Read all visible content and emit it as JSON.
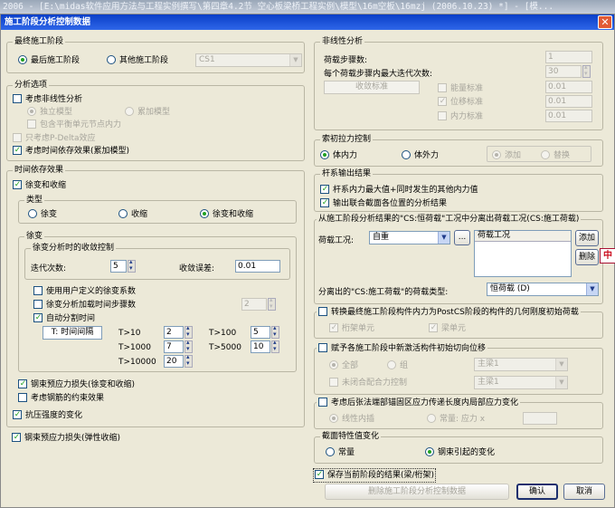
{
  "window": {
    "title": "2006 - [E:\\midas软件应用方法与工程实例撰写\\第四章4.2节 空心板梁桥工程实例\\模型\\16m空板\\16mzj (2006.10.23) *] - [模..."
  },
  "dialog": {
    "title": "施工阶段分析控制数据",
    "close_icon": "close-icon"
  },
  "final_stage": {
    "legend": "最终施工阶段",
    "last": "最后施工阶段",
    "other": "其他施工阶段",
    "other_value": "CS1"
  },
  "analysis": {
    "legend": "分析选项",
    "nonlinear": "考虑非线性分析",
    "independent": "独立模型",
    "cumulative": "累加模型",
    "balance_node": "包含平衡单元节点内力",
    "pdelta": "只考虑P-Delta效应",
    "time_dep": "考虑时间依存效果(累加模型)"
  },
  "time_dependent": {
    "legend": "时间依存效果",
    "creep_shrink": "徐变和收缩",
    "type_legend": "类型",
    "type_creep": "徐变",
    "type_shrink": "收缩",
    "type_both": "徐变和收缩",
    "creep_legend": "徐变",
    "conv_legend": "徐变分析时的收敛控制",
    "iterations_label": "迭代次数:",
    "iterations": "5",
    "error_label": "收敛误差:",
    "error": "0.01",
    "user_coef": "使用用户定义的徐变系数",
    "load_steps": "徐变分析加载时间步骤数",
    "load_steps_value": "2",
    "auto_split": "自动分割时间",
    "t_label": "T: 时间间隔",
    "t10": "T>10",
    "t10_v": "2",
    "t100": "T>100",
    "t100_v": "5",
    "t1000": "T>1000",
    "t1000_v": "7",
    "t5000": "T>5000",
    "t5000_v": "10",
    "t10000": "T>10000",
    "t10000_v": "20",
    "tendon_loss": "钢束预应力损失(徐变和收缩)",
    "rebar": "考虑钢筋的约束效果",
    "strength": "抗压强度的变化",
    "tendon_elastic": "钢束预应力损失(弹性收缩)"
  },
  "nonlinear_analysis": {
    "legend": "非线性分析",
    "load_steps_label": "荷载步骤数:",
    "load_steps": "1",
    "max_iter_label": "每个荷载步骤内最大迭代次数:",
    "max_iter": "30",
    "conv_button": "收敛标准",
    "energy": "能量标准",
    "energy_v": "0.01",
    "disp": "位移标准",
    "disp_v": "0.01",
    "force": "内力标准",
    "force_v": "0.01"
  },
  "cable_control": {
    "legend": "索初拉力控制",
    "internal": "体内力",
    "external": "体外力",
    "add": "添加",
    "replace": "替换"
  },
  "beam_output": {
    "legend": "杆系输出结果",
    "max_min": "杆系内力最大值+同时发生的其他内力值",
    "composite": "输出联合截面各位置的分析结果"
  },
  "separate": {
    "legend": "从施工阶段分析结果的\"CS:恒荷载\"工况中分离出荷载工况(CS:施工荷载)",
    "case_label": "荷载工况:",
    "case_value": "自重",
    "list_header": "荷载工况",
    "add": "添加",
    "delete": "删除",
    "type_label": "分离出的\"CS:施工荷载\"的荷载类型:",
    "type_value": "恒荷载 (D)"
  },
  "convert": {
    "legend": "转换最终施工阶段构件内力为PostCS阶段的构件的几何刚度初始荷载",
    "beam": "桁架单元",
    "plate": "梁单元"
  },
  "tangent": {
    "legend": "赋予各施工阶段中新激活构件初始切向位移",
    "all": "全部",
    "group": "组",
    "group_value": "主梁1",
    "unclosed": "未闭合配合力控制",
    "unclosed_value": "主梁1"
  },
  "anchor": {
    "legend": "考虑后张法端部锚固区应力传递长度内局部应力变化",
    "linear": "线性内插",
    "constant": "常量: 应力 x"
  },
  "section": {
    "legend": "截面特性值变化",
    "constant": "常量",
    "tendon": "钢束引起的变化"
  },
  "save_current": "保存当前阶段的结果(梁/桁架)",
  "buttons": {
    "delete_data": "删除施工阶段分析控制数据",
    "ok": "确认",
    "cancel": "取消"
  },
  "side_icon": "pin-icon"
}
